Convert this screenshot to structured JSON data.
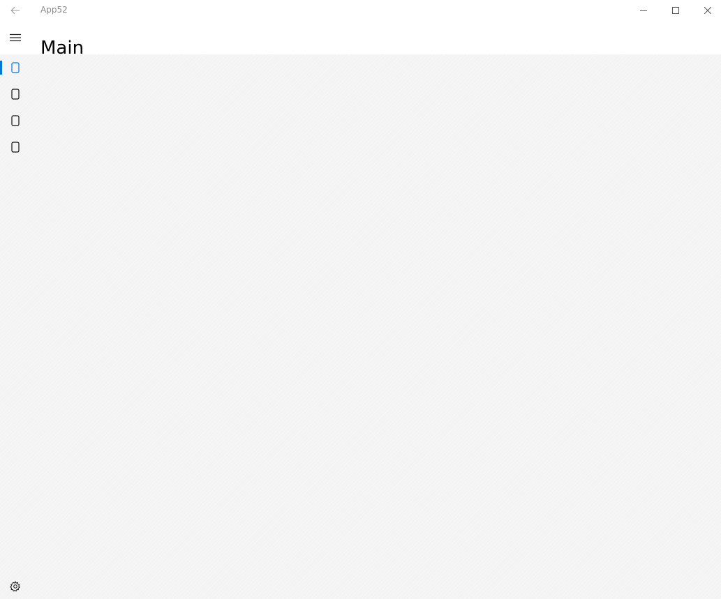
{
  "window": {
    "app_title": "App52"
  },
  "header": {
    "title": "Main"
  },
  "icons": {
    "back": "back-arrow-icon",
    "minimize": "minimize-icon",
    "maximize": "maximize-icon",
    "close": "close-icon",
    "menu": "hamburger-icon",
    "nav_item": "page-icon",
    "settings": "gear-icon"
  },
  "colors": {
    "accent": "#0078d7",
    "content_background": "#f4f4f4"
  },
  "nav": {
    "selected_index": 0,
    "items": [
      {
        "id": "item-1"
      },
      {
        "id": "item-2"
      },
      {
        "id": "item-3"
      },
      {
        "id": "item-4"
      }
    ]
  }
}
